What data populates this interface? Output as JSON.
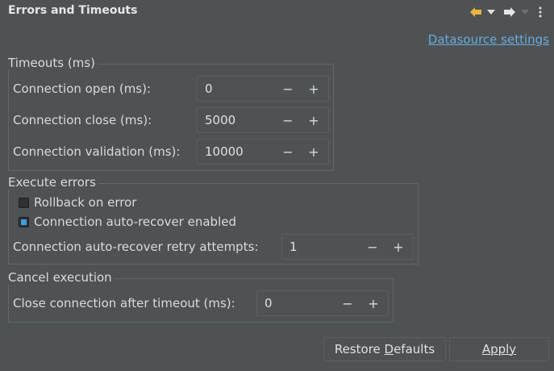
{
  "header": {
    "title": "Errors and Timeouts"
  },
  "toolbar": {
    "back_icon": "arrow-left-icon",
    "dropdown_icon": "chevron-down-icon",
    "forward_icon": "arrow-right-icon",
    "more_icon": "more-vertical-icon"
  },
  "link": {
    "datasource_settings": "Datasource settings"
  },
  "timeouts": {
    "legend": "Timeouts (ms)",
    "rows": [
      {
        "label": "Connection open (ms):",
        "value": "0"
      },
      {
        "label": "Connection close (ms):",
        "value": "5000"
      },
      {
        "label": "Connection validation (ms):",
        "value": "10000"
      }
    ]
  },
  "execute_errors": {
    "legend": "Execute errors",
    "rollback": {
      "label": "Rollback on error",
      "checked": false
    },
    "auto_recover": {
      "label": "Connection auto-recover enabled",
      "checked": true
    },
    "retry": {
      "label": "Connection auto-recover retry attempts:",
      "value": "1"
    }
  },
  "cancel_execution": {
    "legend": "Cancel execution",
    "close_after": {
      "label": "Close connection after timeout (ms):",
      "value": "0"
    }
  },
  "buttons": {
    "restore_defaults_pre": "Restore ",
    "restore_defaults_mnemonic": "D",
    "restore_defaults_post": "efaults",
    "apply": "Apply"
  },
  "spinner_symbols": {
    "minus": "−",
    "plus": "+"
  },
  "colors": {
    "background": "#4e5254",
    "link": "#6aa9dc",
    "checkbox_accent": "#3d9fe0",
    "nav_arrow": "#e9b53d"
  }
}
